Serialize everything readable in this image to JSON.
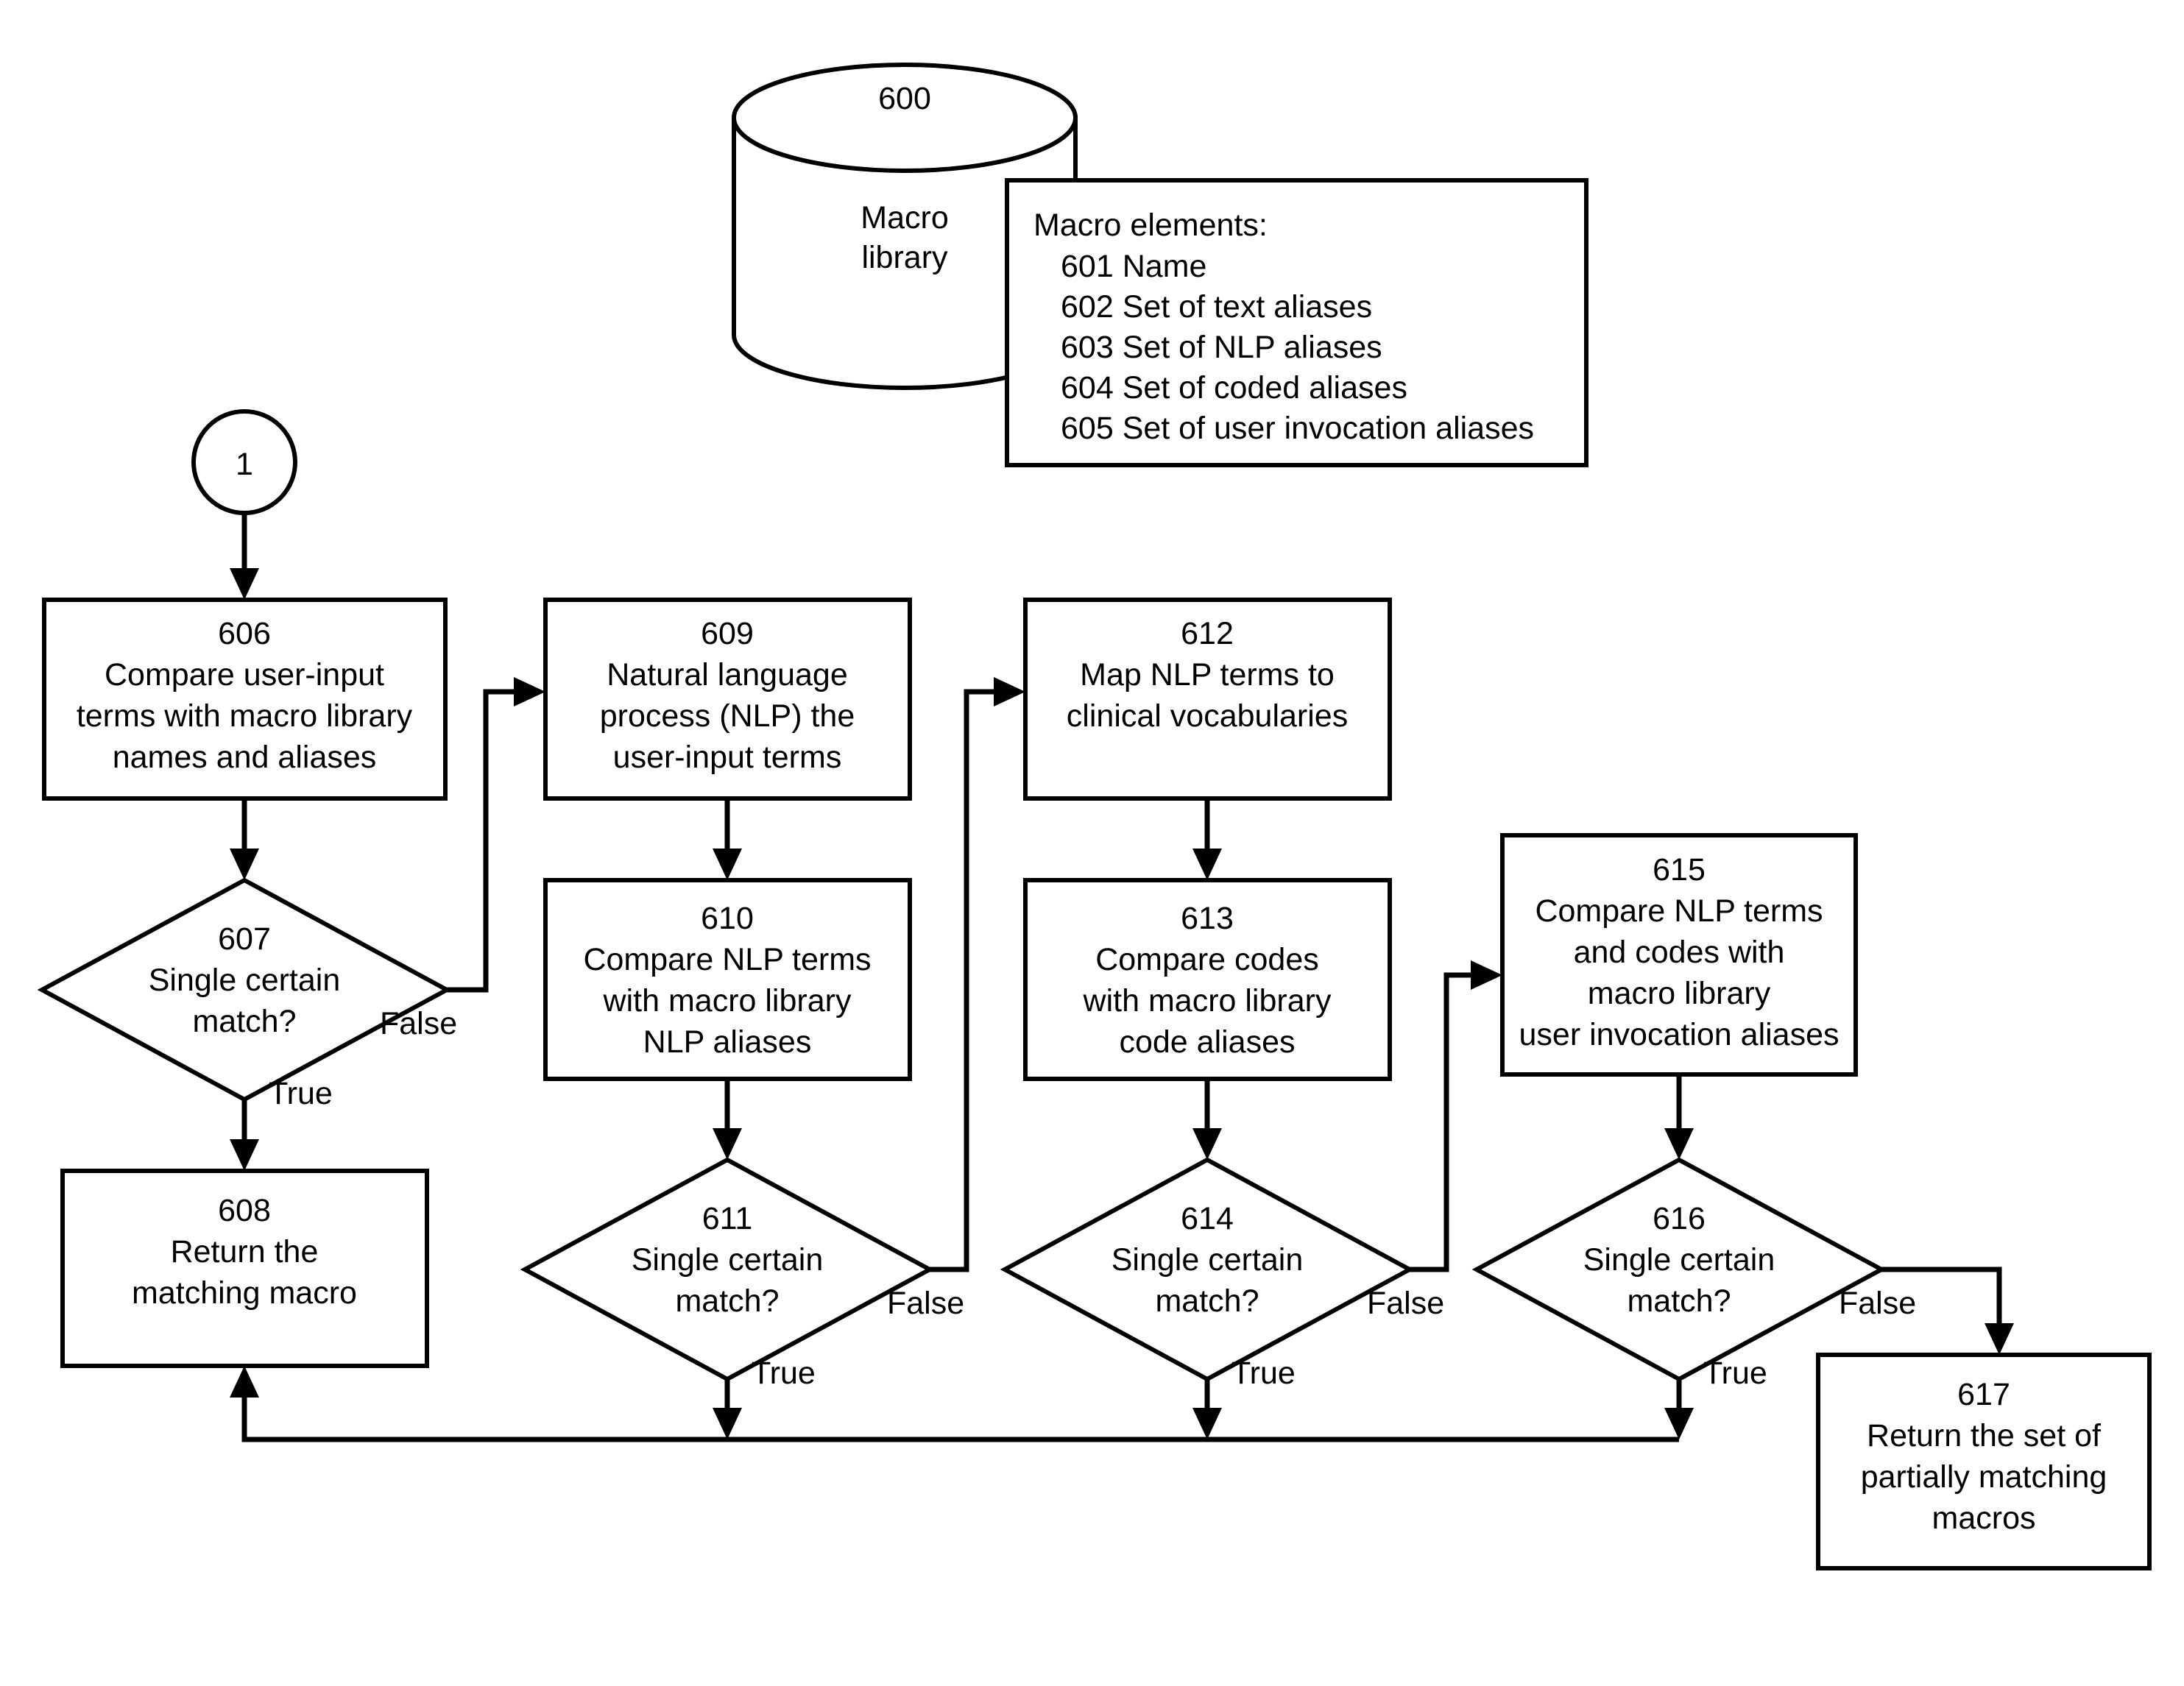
{
  "figure": {
    "type": "flowchart",
    "datastore": {
      "id": "600",
      "label_line1": "Macro",
      "label_line2": "library"
    },
    "elements_box": {
      "title": "Macro elements:",
      "items": [
        "601 Name",
        "602 Set of text aliases",
        "603 Set of NLP aliases",
        "604 Set of coded aliases",
        "605 Set of user invocation aliases"
      ]
    },
    "connector_circle": {
      "label": "1"
    },
    "nodes": [
      {
        "id": "606",
        "shape": "process",
        "lines": [
          "606",
          "Compare user-input",
          "terms with macro library",
          "names and aliases"
        ]
      },
      {
        "id": "607",
        "shape": "decision",
        "lines": [
          "607",
          "Single certain",
          "match?"
        ]
      },
      {
        "id": "608",
        "shape": "process",
        "lines": [
          "608",
          "Return the",
          "matching macro"
        ]
      },
      {
        "id": "609",
        "shape": "process",
        "lines": [
          "609",
          "Natural language",
          "process (NLP) the",
          "user-input terms"
        ]
      },
      {
        "id": "610",
        "shape": "process",
        "lines": [
          "610",
          "Compare NLP terms",
          "with macro library",
          "NLP aliases"
        ]
      },
      {
        "id": "611",
        "shape": "decision",
        "lines": [
          "611",
          "Single certain",
          "match?"
        ]
      },
      {
        "id": "612",
        "shape": "process",
        "lines": [
          "612",
          "Map NLP terms to",
          "clinical vocabularies"
        ]
      },
      {
        "id": "613",
        "shape": "process",
        "lines": [
          "613",
          "Compare codes",
          "with macro library",
          "code aliases"
        ]
      },
      {
        "id": "614",
        "shape": "decision",
        "lines": [
          "614",
          "Single certain",
          "match?"
        ]
      },
      {
        "id": "615",
        "shape": "process",
        "lines": [
          "615",
          "Compare NLP terms",
          "and codes with",
          "macro library",
          "user invocation aliases"
        ]
      },
      {
        "id": "616",
        "shape": "decision",
        "lines": [
          "616",
          "Single certain",
          "match?"
        ]
      },
      {
        "id": "617",
        "shape": "process",
        "lines": [
          "617",
          "Return the set of",
          "partially matching",
          "macros"
        ]
      }
    ],
    "edge_labels": {
      "false_607": "False",
      "true_607": "True",
      "false_611": "False",
      "true_611": "True",
      "false_614": "False",
      "true_614": "True",
      "false_616": "False",
      "true_616": "True"
    },
    "colors": {
      "stroke": "#000000",
      "fill": "#ffffff"
    }
  }
}
